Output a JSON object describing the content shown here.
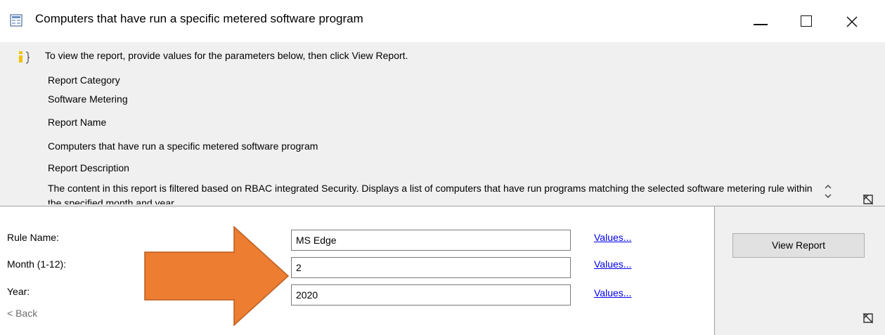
{
  "window": {
    "title": "Computers that have run a specific metered software program",
    "icons": {
      "app": "report-icon",
      "minimize": "minimize-icon",
      "maximize": "maximize-icon",
      "close": "close-icon"
    }
  },
  "info": {
    "icon": "info-icon",
    "instruction": "To view the report, provide values for the parameters below, then click View Report.",
    "category_label": "Report Category",
    "category_value": "Software Metering",
    "name_label": "Report Name",
    "name_value": "Computers that have run a specific metered software program",
    "description_label": "Report Description",
    "description_value": "The content in this report is filtered based on RBAC integrated Security. Displays a list of computers that have run programs matching the selected software metering rule within the specified month and year.",
    "pin_icon": "pin-icon"
  },
  "parameters": [
    {
      "label": "Rule Name:",
      "value": "MS Edge",
      "link": "Values..."
    },
    {
      "label": "Month (1-12):",
      "value": "2",
      "link": "Values..."
    },
    {
      "label": "Year:",
      "value": "2020",
      "link": "Values..."
    }
  ],
  "actions": {
    "view_report": "View Report",
    "back": "< Back"
  },
  "colors": {
    "accent_arrow": "#ed7d31",
    "link": "#0000ee",
    "panel_bg": "#f0f0f0"
  }
}
